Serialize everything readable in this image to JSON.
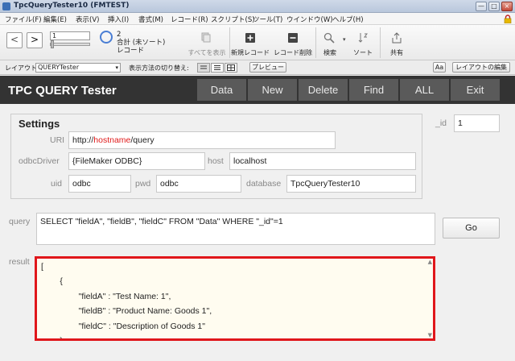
{
  "window": {
    "title": "TpcQueryTester10 (FMTEST)",
    "minimize": "—",
    "maximize": "□",
    "close": "×"
  },
  "menu": [
    "ファイル(F)",
    "編集(E)",
    "表示(V)",
    "挿入(I)",
    "書式(M)",
    "レコード(R)",
    "スクリプト(S)",
    "ツール(T)",
    "ウインドウ(W)",
    "ヘルプ(H)"
  ],
  "toolbar": {
    "back": "<",
    "forward": ">",
    "record_number": "1",
    "record_count": "2",
    "record_status": "合計 (未ソート)",
    "record_label": "レコード",
    "show_all": "すべてを表示",
    "new_record": "新規レコード",
    "delete_record": "レコード削除",
    "find": "検索",
    "sort": "ソート",
    "share": "共有"
  },
  "layoutbar": {
    "layout_label": "レイアウト:",
    "layout_value": "QUERYTester",
    "view_label": "表示方法の切り替え:",
    "preview": "プレビュー",
    "aa": "Aa",
    "edit_layout": "レイアウトの編集"
  },
  "header": {
    "title": "TPC QUERY Tester",
    "buttons": [
      "Data",
      "New",
      "Delete",
      "Find",
      "ALL",
      "Exit"
    ]
  },
  "settings": {
    "title": "Settings",
    "uri_label": "URI",
    "uri_prefix": "http://",
    "uri_host": "hostname",
    "uri_suffix": "/query",
    "odbc_label": "odbcDriver",
    "odbc_value": "{FileMaker ODBC}",
    "host_label": "host",
    "host_value": "localhost",
    "uid_label": "uid",
    "uid_value": "odbc",
    "pwd_label": "pwd",
    "pwd_value": "odbc",
    "database_label": "database",
    "database_value": "TpcQueryTester10"
  },
  "id": {
    "label": "_id",
    "value": "1"
  },
  "query": {
    "label": "query",
    "value": "SELECT \"fieldA\", \"fieldB\", \"fieldC\" FROM \"Data\" WHERE \"_id\"=1",
    "go": "Go"
  },
  "result": {
    "label": "result",
    "value": "[\n        {\n                \"fieldA\" : \"Test Name: 1\",\n                \"fieldB\" : \"Product Name: Goods 1\",\n                \"fieldC\" : \"Description of Goods 1\"\n        }"
  },
  "colors": {
    "header_bg": "#333333",
    "header_button": "#5a5a5a",
    "highlight": "#e0161b",
    "uri_host": "#e01b1b"
  }
}
